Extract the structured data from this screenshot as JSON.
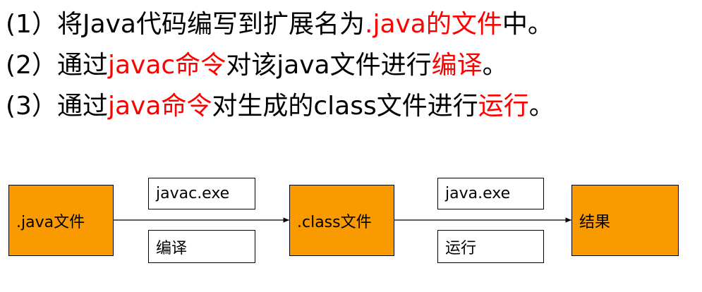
{
  "steps": [
    {
      "parts": [
        {
          "text": "(1）将Java代码编写到扩展名为",
          "accent": false
        },
        {
          "text": ".java的文件",
          "accent": true
        },
        {
          "text": "中。",
          "accent": false
        }
      ]
    },
    {
      "parts": [
        {
          "text": "(2）通过",
          "accent": false
        },
        {
          "text": "javac命令",
          "accent": true
        },
        {
          "text": "对该java文件进行",
          "accent": false
        },
        {
          "text": "编译",
          "accent": true
        },
        {
          "text": "。",
          "accent": false
        }
      ]
    },
    {
      "parts": [
        {
          "text": "(3）通过",
          "accent": false
        },
        {
          "text": "java命令",
          "accent": true
        },
        {
          "text": "对生成的class文件进行",
          "accent": false
        },
        {
          "text": "运行",
          "accent": true
        },
        {
          "text": "。",
          "accent": false
        }
      ]
    }
  ],
  "flow": {
    "node_java": ".java文件",
    "node_class": ".class文件",
    "node_result": "结果",
    "compile_tool": "javac.exe",
    "compile_label": "编译",
    "run_tool": "java.exe",
    "run_label": "运行"
  },
  "colors": {
    "accent": "#ff0000",
    "node_fill": "#f99a00"
  }
}
